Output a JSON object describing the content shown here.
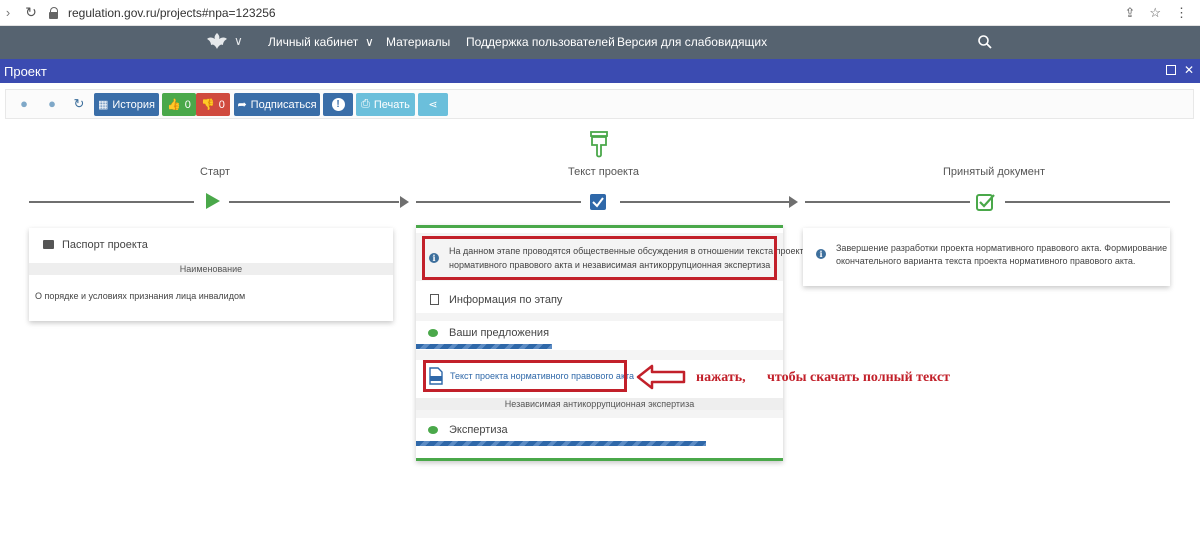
{
  "browser": {
    "url": "regulation.gov.ru/projects#npa=123256"
  },
  "nav": {
    "items": [
      "Личный кабинет",
      "Материалы",
      "Поддержка пользователей",
      "Версия для слабовидящих"
    ]
  },
  "window": {
    "title": "Проект"
  },
  "toolbar": {
    "history_label": "История",
    "likes": "0",
    "dislikes": "0",
    "subscribe_label": "Подписаться",
    "print_label": "Печать"
  },
  "steps": {
    "start": {
      "label": "Старт",
      "passport_label": "Паспорт проекта",
      "name_header": "Наименование",
      "name_value": "О порядке и условиях признания лица инвалидом"
    },
    "text": {
      "label": "Текст проекта",
      "info_line1": "На данном этапе проводятся общественные обсуждения в отношении текста проекта",
      "info_line2": "нормативного правового акта и независимая антикоррупционная экспертиза",
      "stage_info": "Информация по этапу",
      "proposals": "Ваши предложения",
      "doc_link": "Текст проекта нормативного правового акта",
      "anticorruption_header": "Независимая антикоррупционная экспертиза",
      "expertise": "Экспертиза"
    },
    "accepted": {
      "label": "Принятый документ",
      "info_line1": "Завершение разработки проекта нормативного правового акта. Формирование",
      "info_line2": "окончательного варианта текста проекта нормативного правового акта."
    }
  },
  "annotation": {
    "part1": "нажать,",
    "part2": "чтобы скачать полный текст"
  },
  "colors": {
    "nav": "#566370",
    "title_bar": "#3b4bb1",
    "accent_green": "#4aa84a",
    "annotation_red": "#c2202a"
  }
}
